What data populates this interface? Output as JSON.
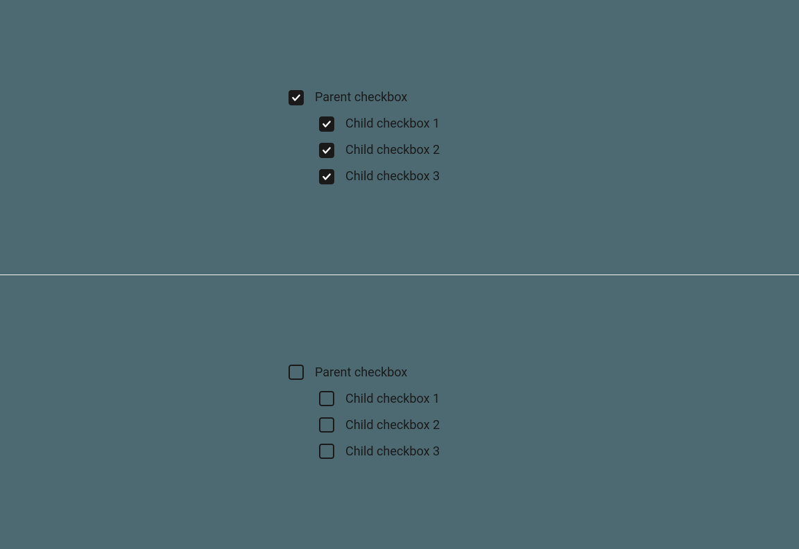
{
  "groups": [
    {
      "parent": {
        "label": "Parent checkbox",
        "checked": true
      },
      "children": [
        {
          "label": "Child checkbox 1",
          "checked": true
        },
        {
          "label": "Child checkbox 2",
          "checked": true
        },
        {
          "label": "Child checkbox 3",
          "checked": true
        }
      ]
    },
    {
      "parent": {
        "label": "Parent checkbox",
        "checked": false
      },
      "children": [
        {
          "label": "Child checkbox 1",
          "checked": false
        },
        {
          "label": "Child checkbox 2",
          "checked": false
        },
        {
          "label": "Child checkbox 3",
          "checked": false
        }
      ]
    }
  ]
}
